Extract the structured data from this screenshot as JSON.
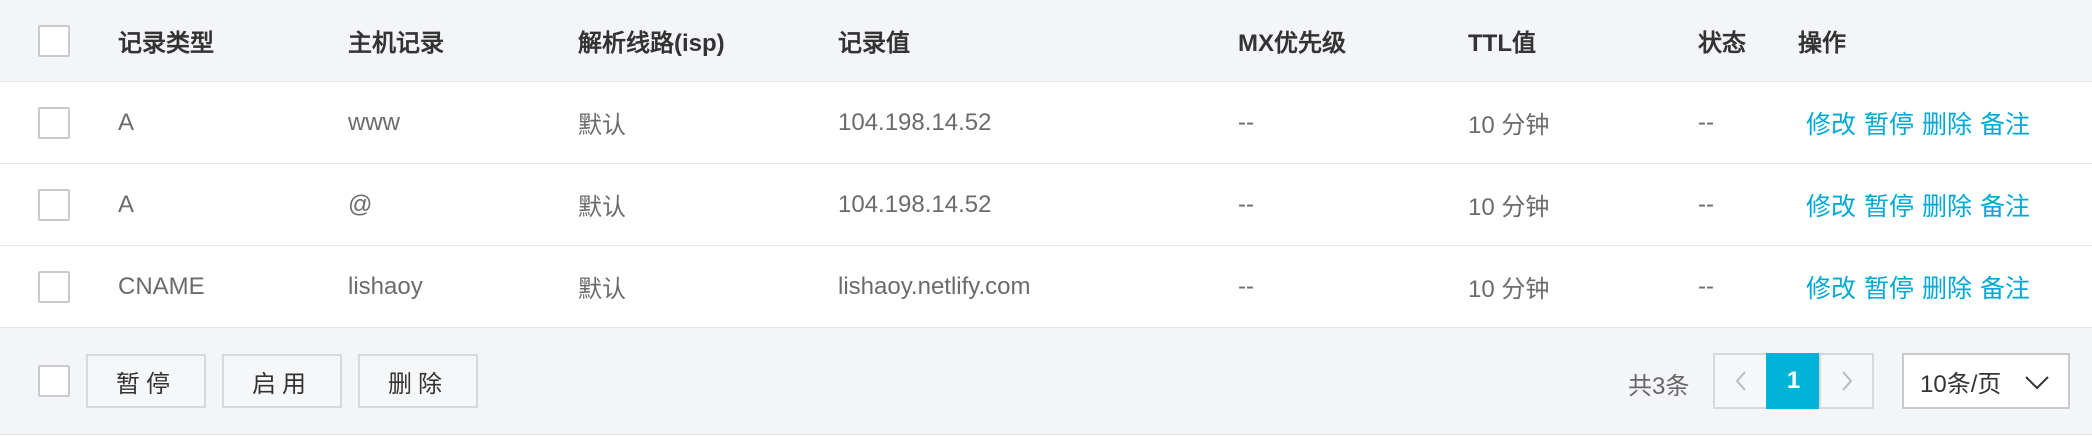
{
  "header": {
    "type": "记录类型",
    "host": "主机记录",
    "line": "解析线路(isp)",
    "value": "记录值",
    "mx": "MX优先级",
    "ttl": "TTL值",
    "status": "状态",
    "ops": "操作"
  },
  "rows": [
    {
      "type": "A",
      "host": "www",
      "line": "默认",
      "value": "104.198.14.52",
      "mx": "--",
      "ttl": "10 分钟",
      "status": "--"
    },
    {
      "type": "A",
      "host": "@",
      "line": "默认",
      "value": "104.198.14.52",
      "mx": "--",
      "ttl": "10 分钟",
      "status": "--"
    },
    {
      "type": "CNAME",
      "host": "lishaoy",
      "line": "默认",
      "value": "lishaoy.netlify.com",
      "mx": "--",
      "ttl": "10 分钟",
      "status": "--"
    }
  ],
  "row_actions": {
    "edit": "修改",
    "pause": "暂停",
    "delete": "删除",
    "note": "备注"
  },
  "footer": {
    "pause_btn": "暂停",
    "enable_btn": "启用",
    "delete_btn": "删除",
    "total": "共3条",
    "current_page": "1",
    "page_size": "10条/页"
  },
  "colors": {
    "accent": "#00b2d6",
    "link": "#00a8d6",
    "header_bg": "#f4f5f8"
  },
  "icons": {
    "prev": "chevron-left-icon",
    "next": "chevron-right-icon",
    "dropdown": "chevron-down-icon"
  }
}
